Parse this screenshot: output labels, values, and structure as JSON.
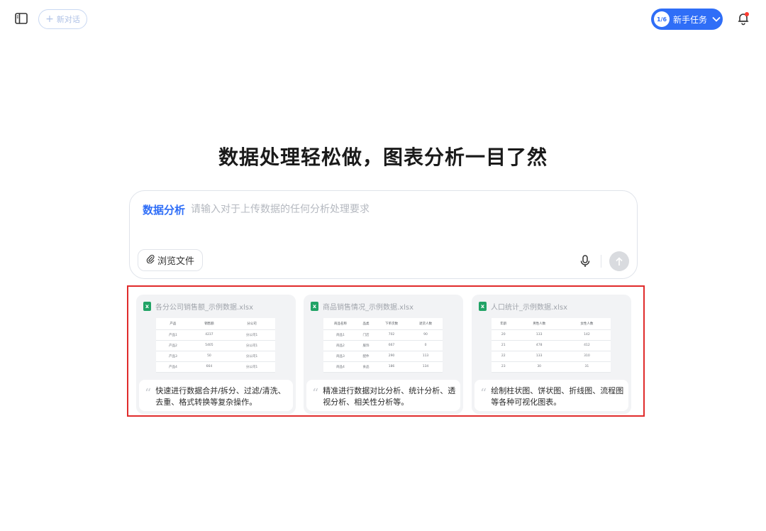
{
  "header": {
    "new_chat_label": "新对话",
    "task_badge": "1/6",
    "task_label": "新手任务"
  },
  "headline": "数据处理轻松做，图表分析一目了然",
  "composer": {
    "mode_label": "数据分析",
    "placeholder": "请输入对于上传数据的任何分析处理要求",
    "browse_label": "浏览文件"
  },
  "cards": [
    {
      "file_name": "各分公司销售额_示例数据.xlsx",
      "columns": [
        "产品",
        "销售额",
        "分公司"
      ],
      "rows": [
        [
          "产品1",
          "4237",
          "分公司1"
        ],
        [
          "产品2",
          "5405",
          "分公司1"
        ],
        [
          "产品3",
          "50",
          "分公司1"
        ],
        [
          "产品4",
          "664",
          "分公司1"
        ]
      ],
      "description": "快速进行数据合并/拆分、过滤/清洗、去重、格式转换等复杂操作。"
    },
    {
      "file_name": "商品销售情况_示例数据.xlsx",
      "columns": [
        "商品名称",
        "品类",
        "下单次数",
        "退货人数"
      ],
      "rows": [
        [
          "商品1",
          "门店",
          "702",
          "90"
        ],
        [
          "商品2",
          "服饰",
          "667",
          "0"
        ],
        [
          "商品3",
          "配件",
          "290",
          "113"
        ],
        [
          "商品4",
          "食品",
          "186",
          "134"
        ]
      ],
      "description": "精准进行数据对比分析、统计分析、透视分析、相关性分析等。"
    },
    {
      "file_name": "人口统计_示例数据.xlsx",
      "columns": [
        "年龄",
        "男性人数",
        "女性人数"
      ],
      "rows": [
        [
          "20",
          "133",
          "142"
        ],
        [
          "21",
          "478",
          "412"
        ],
        [
          "22",
          "133",
          "310"
        ],
        [
          "23",
          "30",
          "31"
        ]
      ],
      "description": "绘制柱状图、饼状图、折线图、流程图等各种可视化图表。"
    }
  ]
}
